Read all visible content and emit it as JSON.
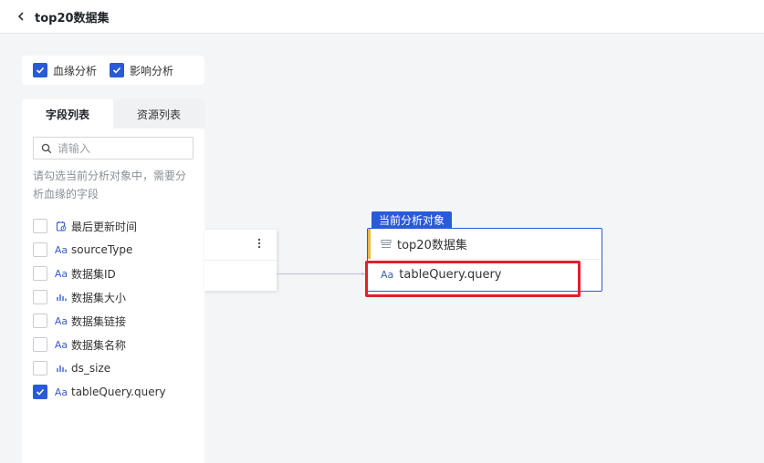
{
  "header": {
    "title": "top20数据集"
  },
  "analysis_toggles": [
    {
      "label": "血缘分析",
      "checked": true
    },
    {
      "label": "影响分析",
      "checked": true
    }
  ],
  "panel": {
    "tabs": [
      {
        "label": "字段列表",
        "active": true
      },
      {
        "label": "资源列表",
        "active": false
      }
    ],
    "search": {
      "placeholder": "请输入",
      "value": ""
    },
    "hint": "请勾选当前分析对象中，需要分析血缘的字段",
    "fields": [
      {
        "name": "最后更新时间",
        "type_icon": "datetime-icon",
        "checked": false
      },
      {
        "name": "sourceType",
        "type_icon": "text-type-icon",
        "checked": false
      },
      {
        "name": "数据集ID",
        "type_icon": "text-type-icon",
        "checked": false
      },
      {
        "name": "数据集大小",
        "type_icon": "numeric-type-icon",
        "checked": false
      },
      {
        "name": "数据集链接",
        "type_icon": "text-type-icon",
        "checked": false
      },
      {
        "name": "数据集名称",
        "type_icon": "text-type-icon",
        "checked": false
      },
      {
        "name": "ds_size",
        "type_icon": "numeric-type-icon",
        "checked": false
      },
      {
        "name": "tableQuery.query",
        "type_icon": "text-type-icon",
        "checked": true
      }
    ]
  },
  "graph": {
    "target_tag": "当前分析对象",
    "target_node": {
      "title": "top20数据集",
      "field": "tableQuery.query"
    }
  },
  "icon_text": {
    "text_type": "Aa"
  },
  "colors": {
    "accent": "#2a5bd7",
    "highlight": "#e0202a",
    "node_accent": "#e7b84a"
  }
}
